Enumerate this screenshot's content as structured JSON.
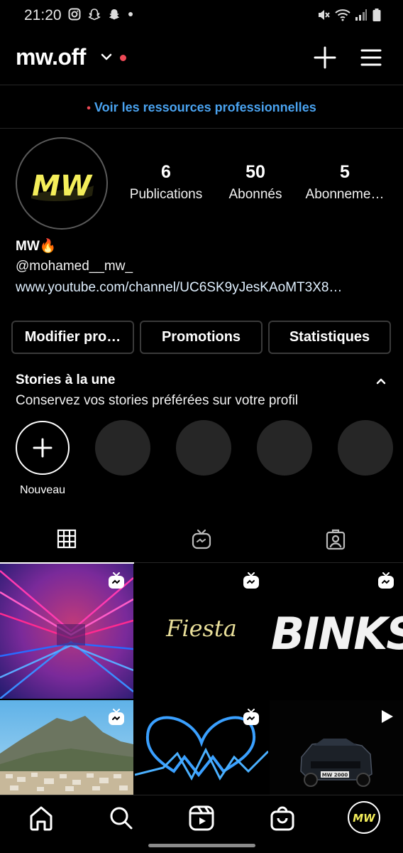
{
  "status_bar": {
    "time": "21:20",
    "left_icons": [
      "instagram-icon",
      "snapchat-icon",
      "snapchat-icon",
      "dot-icon"
    ],
    "right_icons": [
      "mute-icon",
      "wifi-icon",
      "signal-icon",
      "battery-icon"
    ]
  },
  "header": {
    "username": "mw.off",
    "has_notification_dot": true,
    "icons": [
      "chevron-down-icon",
      "plus-icon",
      "hamburger-menu-icon"
    ]
  },
  "pro_banner": {
    "bullet": "•",
    "text": "Voir les ressources professionnelles"
  },
  "profile": {
    "avatar_text": "MW",
    "stats": [
      {
        "value": "6",
        "label": "Publications"
      },
      {
        "value": "50",
        "label": "Abonnés"
      },
      {
        "value": "5",
        "label": "Abonneme…"
      }
    ],
    "name": "MW🔥",
    "handle": "@mohamed__mw_",
    "link": "www.youtube.com/channel/UC6SK9yJesKAoMT3X8…"
  },
  "actions": {
    "edit": "Modifier pro…",
    "promotions": "Promotions",
    "insights": "Statistiques"
  },
  "stories": {
    "title": "Stories à la une",
    "subtitle": "Conservez vos stories préférées sur votre profil",
    "new_label": "Nouveau"
  },
  "tabs": [
    "grid-icon",
    "igtv-icon",
    "tagged-icon"
  ],
  "grid": {
    "fiesta_text": "Fiesta",
    "binks_text": "BINKS",
    "car_plate": "MW 2000"
  },
  "bottom_nav": [
    "home-icon",
    "search-icon",
    "reels-icon",
    "shop-icon",
    "profile-avatar"
  ],
  "colors": {
    "background": "#000000",
    "accent_link": "#4aa3f0",
    "notification": "#ed4956",
    "avatar_yellow": "#f4ee5a",
    "divider": "#262626"
  }
}
